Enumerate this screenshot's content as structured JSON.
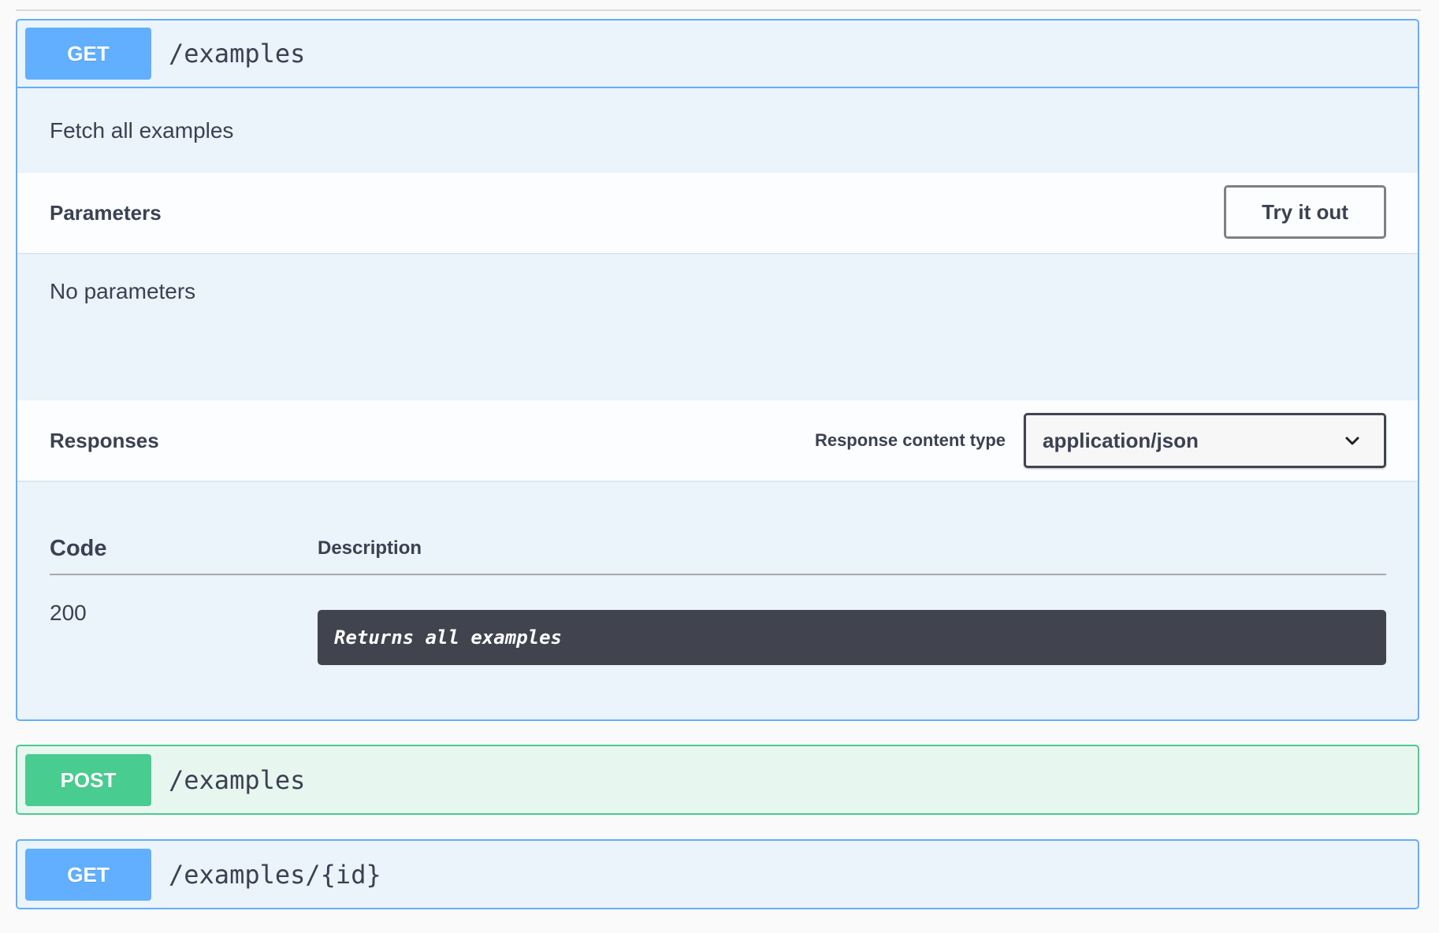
{
  "operations": [
    {
      "method": "GET",
      "path": "/examples",
      "summary": "Fetch all examples",
      "parameters": {
        "title": "Parameters",
        "try_button": "Try it out",
        "empty_text": "No parameters"
      },
      "responses": {
        "title": "Responses",
        "content_type_label": "Response content type",
        "content_type_value": "application/json",
        "columns": {
          "code": "Code",
          "description": "Description"
        },
        "rows": [
          {
            "code": "200",
            "description": "Returns all examples"
          }
        ]
      }
    },
    {
      "method": "POST",
      "path": "/examples"
    },
    {
      "method": "GET",
      "path": "/examples/{id}"
    }
  ],
  "colors": {
    "get": "#61affe",
    "post": "#49cc90",
    "text": "#3b4151"
  },
  "icons": {
    "select_chevron": "chevron-down-icon"
  }
}
